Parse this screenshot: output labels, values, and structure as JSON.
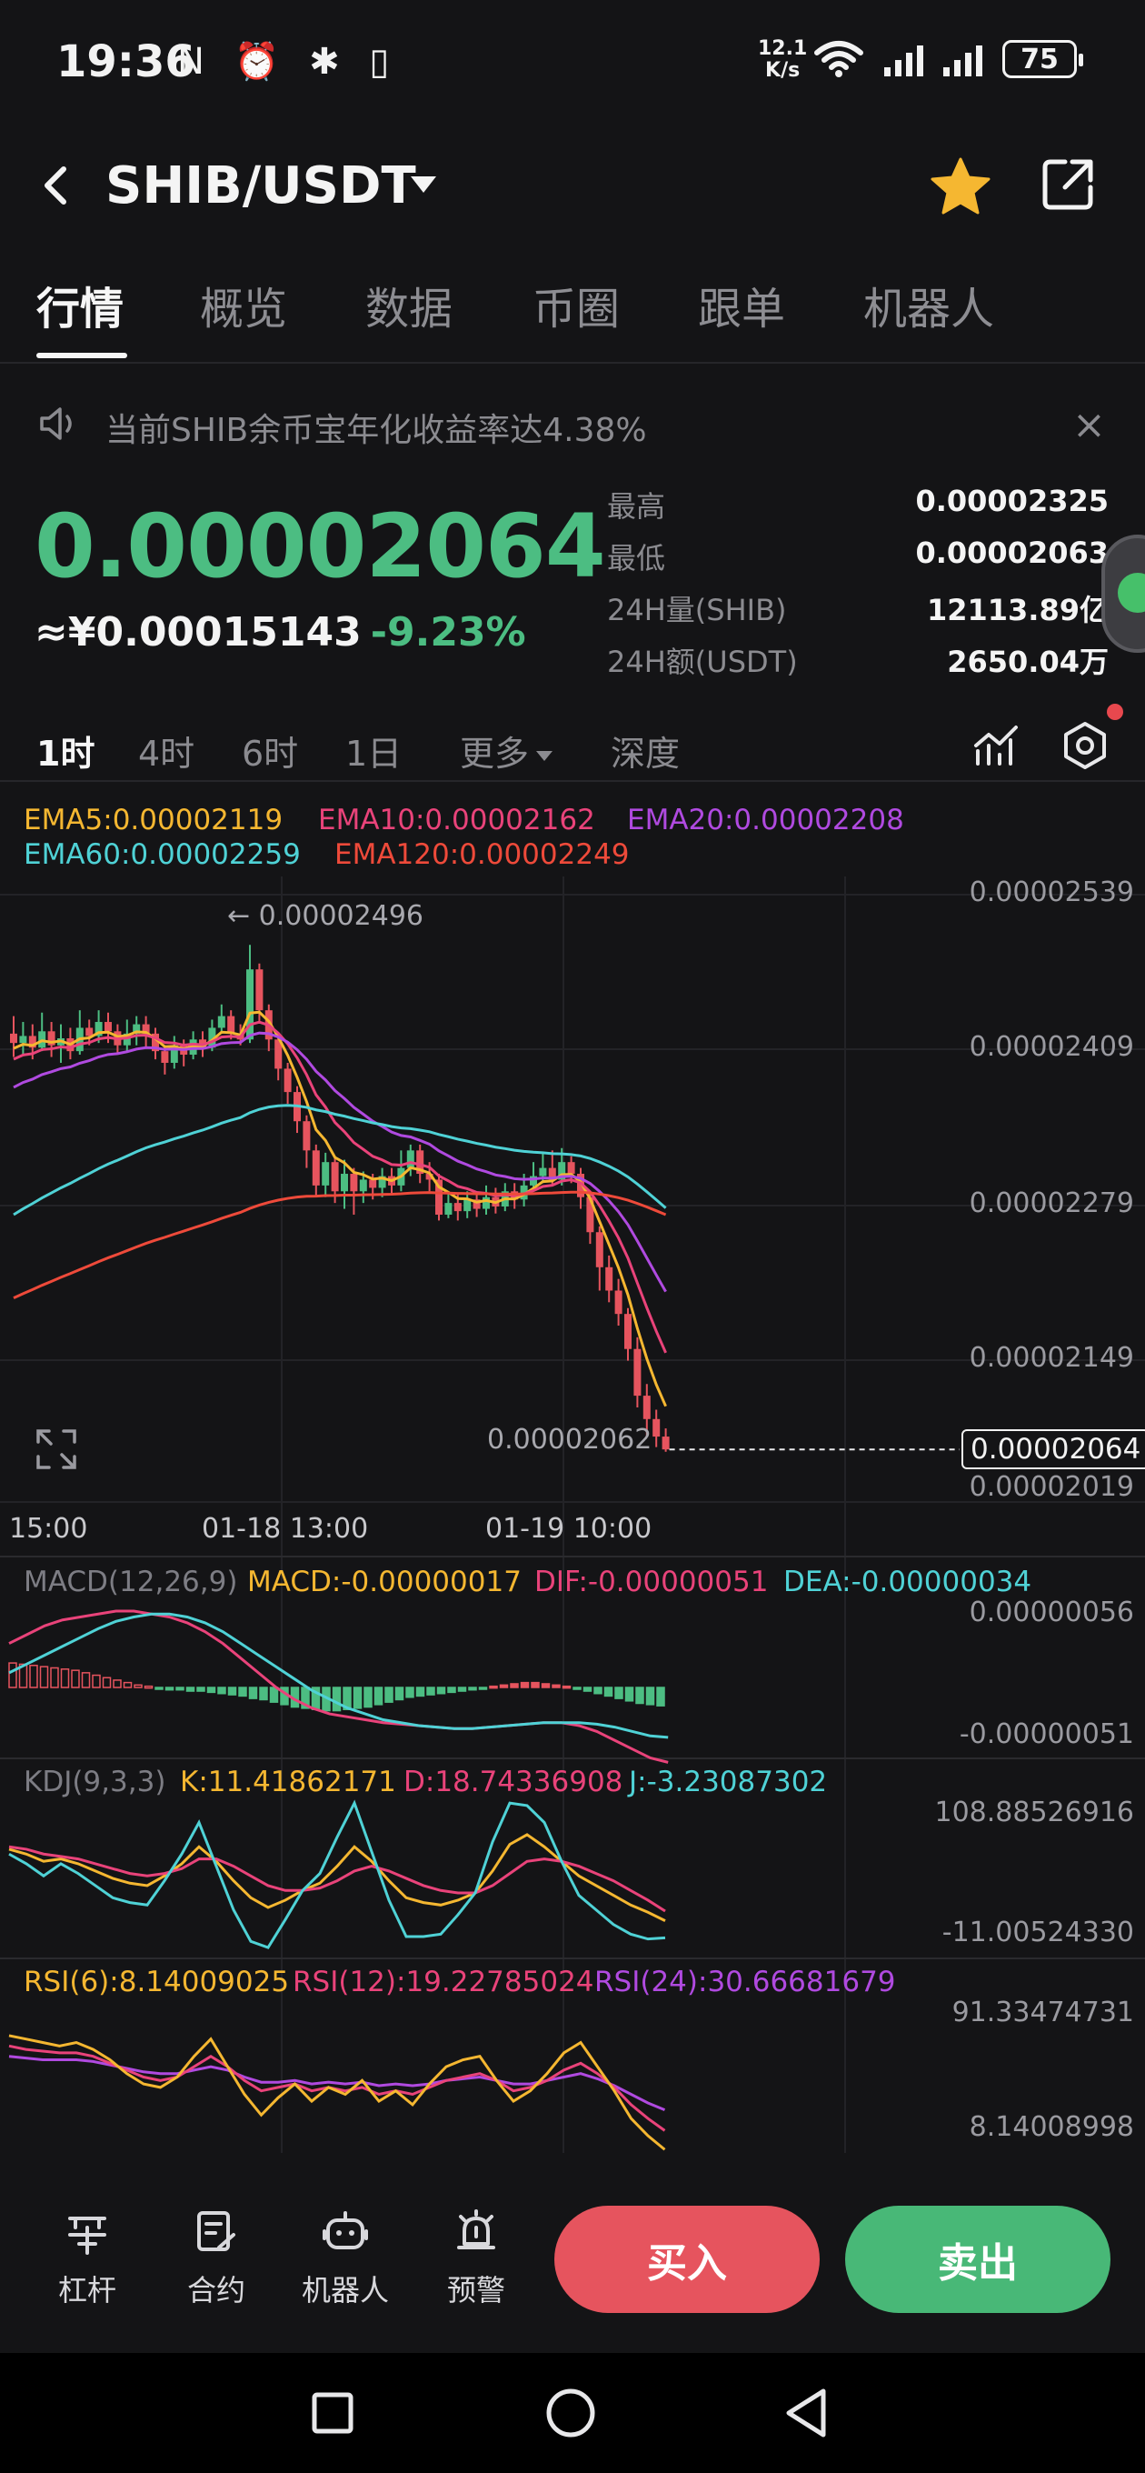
{
  "status_bar": {
    "time": "19:36",
    "left_icons": "N ⏰ ✱ ▯",
    "net_speed_value": "12.1",
    "net_speed_unit": "K/s",
    "battery": "75"
  },
  "header": {
    "pair": "SHIB/USDT",
    "favorite_color": "#f5b731"
  },
  "tabs": [
    "行情",
    "概览",
    "数据",
    "币圈",
    "跟单",
    "机器人"
  ],
  "notice": {
    "text": "当前SHIB余币宝年化收益率达4.38%",
    "close": "×"
  },
  "ticker": {
    "price": "0.00002064",
    "price_cny": "≈¥0.00015143",
    "change": "-9.23%",
    "stats": [
      {
        "label": "最高",
        "value": "0.00002325"
      },
      {
        "label": "最低",
        "value": "0.00002063"
      },
      {
        "label": "24H量(SHIB)",
        "value": "12113.89亿"
      },
      {
        "label": "24H额(USDT)",
        "value": "2650.04万"
      }
    ]
  },
  "timeframes": {
    "items": [
      "1时",
      "4时",
      "6时",
      "1日"
    ],
    "more": "更多",
    "depth": "深度",
    "active": "1时"
  },
  "chart_data": [
    {
      "type": "line",
      "title": "",
      "legend": [
        {
          "name": "EMA5:0.00002119",
          "color": "#f5b731"
        },
        {
          "name": "EMA10:0.00002162",
          "color": "#e9437a"
        },
        {
          "name": "EMA20:0.00002208",
          "color": "#b04ae0"
        },
        {
          "name": "EMA60:0.00002259",
          "color": "#4fd2d6"
        },
        {
          "name": "EMA120:0.00002249",
          "color": "#ee4a3a"
        }
      ],
      "y_ticks": [
        "0.00002539",
        "0.00002409",
        "0.00002279",
        "0.00002149",
        "0.00002019"
      ],
      "x_ticks": [
        "15:00",
        "01-18 13:00",
        "01-19 10:00"
      ],
      "ylim": [
        2.019e-05,
        2.539e-05
      ],
      "high_marker": "← 0.00002496",
      "low_marker": "0.00002062",
      "last_price": "0.00002064",
      "colors": {
        "up": "#4cbd82",
        "down": "#e6545e"
      },
      "candles": [
        [
          2420,
          2412,
          2435,
          2400
        ],
        [
          2412,
          2418,
          2430,
          2402
        ],
        [
          2418,
          2408,
          2428,
          2398
        ],
        [
          2408,
          2422,
          2438,
          2405
        ],
        [
          2422,
          2410,
          2430,
          2400
        ],
        [
          2410,
          2416,
          2428,
          2395
        ],
        [
          2416,
          2405,
          2425,
          2398
        ],
        [
          2405,
          2425,
          2440,
          2402
        ],
        [
          2425,
          2418,
          2432,
          2410
        ],
        [
          2418,
          2430,
          2440,
          2412
        ],
        [
          2430,
          2422,
          2438,
          2412
        ],
        [
          2422,
          2410,
          2428,
          2402
        ],
        [
          2410,
          2420,
          2432,
          2405
        ],
        [
          2420,
          2428,
          2435,
          2410
        ],
        [
          2428,
          2420,
          2435,
          2408
        ],
        [
          2420,
          2405,
          2425,
          2398
        ],
        [
          2405,
          2395,
          2410,
          2385
        ],
        [
          2395,
          2410,
          2418,
          2390
        ],
        [
          2410,
          2402,
          2415,
          2392
        ],
        [
          2402,
          2415,
          2422,
          2398
        ],
        [
          2415,
          2408,
          2422,
          2400
        ],
        [
          2408,
          2425,
          2432,
          2405
        ],
        [
          2425,
          2435,
          2445,
          2420
        ],
        [
          2435,
          2420,
          2440,
          2415
        ],
        [
          2420,
          2415,
          2428,
          2410
        ],
        [
          2415,
          2475,
          2496,
          2412
        ],
        [
          2475,
          2440,
          2480,
          2430
        ],
        [
          2440,
          2415,
          2445,
          2405
        ],
        [
          2415,
          2390,
          2420,
          2380
        ],
        [
          2390,
          2370,
          2395,
          2360
        ],
        [
          2370,
          2345,
          2375,
          2335
        ],
        [
          2345,
          2320,
          2350,
          2305
        ],
        [
          2320,
          2290,
          2325,
          2280
        ],
        [
          2290,
          2310,
          2318,
          2280
        ],
        [
          2310,
          2285,
          2315,
          2275
        ],
        [
          2285,
          2300,
          2312,
          2270
        ],
        [
          2300,
          2285,
          2305,
          2265
        ],
        [
          2285,
          2295,
          2302,
          2275
        ],
        [
          2295,
          2288,
          2300,
          2278
        ],
        [
          2288,
          2298,
          2305,
          2280
        ],
        [
          2298,
          2290,
          2305,
          2282
        ],
        [
          2290,
          2305,
          2320,
          2285
        ],
        [
          2305,
          2320,
          2325,
          2298
        ],
        [
          2320,
          2300,
          2325,
          2292
        ],
        [
          2300,
          2295,
          2310,
          2285
        ],
        [
          2295,
          2265,
          2300,
          2260
        ],
        [
          2265,
          2275,
          2285,
          2262
        ],
        [
          2275,
          2268,
          2282,
          2260
        ],
        [
          2268,
          2278,
          2285,
          2262
        ],
        [
          2278,
          2270,
          2285,
          2263
        ],
        [
          2270,
          2280,
          2290,
          2265
        ],
        [
          2280,
          2272,
          2288,
          2266
        ],
        [
          2272,
          2285,
          2292,
          2268
        ],
        [
          2285,
          2278,
          2292,
          2270
        ],
        [
          2278,
          2290,
          2300,
          2272
        ],
        [
          2290,
          2298,
          2310,
          2285
        ],
        [
          2298,
          2305,
          2318,
          2292
        ],
        [
          2305,
          2295,
          2320,
          2290
        ],
        [
          2295,
          2310,
          2322,
          2290
        ],
        [
          2310,
          2300,
          2315,
          2292
        ],
        [
          2300,
          2280,
          2305,
          2270
        ],
        [
          2280,
          2250,
          2285,
          2240
        ],
        [
          2250,
          2220,
          2255,
          2200
        ],
        [
          2220,
          2200,
          2230,
          2190
        ],
        [
          2200,
          2180,
          2210,
          2170
        ],
        [
          2180,
          2150,
          2185,
          2140
        ],
        [
          2150,
          2110,
          2160,
          2100
        ],
        [
          2110,
          2090,
          2120,
          2075
        ],
        [
          2090,
          2075,
          2098,
          2066
        ],
        [
          2075,
          2064,
          2082,
          2062
        ]
      ]
    },
    {
      "type": "bar",
      "title": "MACD(12,26,9)",
      "legend": [
        {
          "name": "MACD:-0.00000017",
          "color": "#f5b731"
        },
        {
          "name": "DIF:-0.00000051",
          "color": "#e9437a"
        },
        {
          "name": "DEA:-0.00000034",
          "color": "#4fd2d6"
        }
      ],
      "y_ticks": [
        "0.00000056",
        "-0.00000051"
      ],
      "ylim": [
        -51,
        56
      ],
      "histogram": [
        20,
        19,
        18,
        17,
        16,
        15,
        14,
        12,
        10,
        8,
        6,
        4,
        2,
        1,
        -1,
        -2,
        -2,
        -3,
        -3,
        -4,
        -5,
        -6,
        -7,
        -9,
        -10,
        -12,
        -14,
        -16,
        -17,
        -18,
        -19,
        -19,
        -18,
        -17,
        -16,
        -14,
        -12,
        -10,
        -8,
        -7,
        -6,
        -5,
        -4,
        -3,
        -2,
        -1,
        1,
        2,
        3,
        4,
        4,
        3,
        2,
        1,
        -1,
        -3,
        -5,
        -7,
        -9,
        -11,
        -13,
        -14,
        -15
      ],
      "dif": [
        30,
        36,
        42,
        46,
        48,
        50,
        52,
        52,
        50,
        48,
        44,
        38,
        30,
        20,
        10,
        0,
        -8,
        -14,
        -18,
        -20,
        -22,
        -24,
        -25,
        -26,
        -27,
        -28,
        -28,
        -27,
        -26,
        -25,
        -24,
        -24,
        -26,
        -30,
        -36,
        -42,
        -48,
        -51
      ],
      "dea": [
        10,
        16,
        22,
        28,
        34,
        40,
        45,
        48,
        50,
        50,
        48,
        44,
        38,
        30,
        22,
        14,
        6,
        -2,
        -8,
        -14,
        -18,
        -22,
        -24,
        -26,
        -27,
        -28,
        -28,
        -27,
        -26,
        -25,
        -24,
        -24,
        -24,
        -25,
        -27,
        -30,
        -33,
        -34
      ]
    },
    {
      "type": "line",
      "title": "KDJ(9,3,3)",
      "legend": [
        {
          "name": "K:11.41862171",
          "color": "#f5b731"
        },
        {
          "name": "D:18.74336908",
          "color": "#e9437a"
        },
        {
          "name": "J:-3.23087302",
          "color": "#4fd2d6"
        }
      ],
      "y_ticks": [
        "108.88526916",
        "-11.00524330"
      ],
      "ylim": [
        -11.0,
        108.9
      ],
      "k": [
        70,
        66,
        60,
        62,
        58,
        52,
        46,
        42,
        40,
        48,
        58,
        72,
        60,
        44,
        30,
        22,
        28,
        36,
        42,
        56,
        72,
        60,
        44,
        30,
        26,
        24,
        28,
        34,
        52,
        74,
        82,
        72,
        60,
        48,
        40,
        32,
        24,
        18,
        11
      ],
      "d": [
        72,
        70,
        66,
        64,
        62,
        58,
        54,
        50,
        48,
        50,
        54,
        62,
        62,
        56,
        48,
        40,
        36,
        36,
        38,
        44,
        52,
        56,
        52,
        46,
        40,
        36,
        34,
        34,
        40,
        50,
        60,
        62,
        60,
        56,
        50,
        44,
        36,
        28,
        19
      ],
      "j": [
        66,
        58,
        48,
        58,
        50,
        40,
        30,
        26,
        24,
        44,
        66,
        92,
        56,
        20,
        -6,
        -11,
        12,
        36,
        50,
        80,
        108,
        68,
        28,
        -2,
        -2,
        0,
        16,
        34,
        76,
        108,
        106,
        92,
        60,
        32,
        20,
        8,
        0,
        -4,
        -3
      ]
    },
    {
      "type": "line",
      "title": "",
      "legend": [
        {
          "name": "RSI(6):8.14009025",
          "color": "#f5b731"
        },
        {
          "name": "RSI(12):19.22785024",
          "color": "#e9437a"
        },
        {
          "name": "RSI(24):30.66681679",
          "color": "#b04ae0"
        }
      ],
      "y_ticks": [
        "91.33474731",
        "8.14008998"
      ],
      "ylim": [
        8.14,
        91.33
      ],
      "rsi6": [
        74,
        72,
        70,
        68,
        70,
        66,
        60,
        52,
        46,
        44,
        50,
        62,
        72,
        56,
        40,
        28,
        38,
        46,
        36,
        44,
        40,
        48,
        36,
        42,
        34,
        46,
        56,
        60,
        62,
        48,
        36,
        42,
        52,
        64,
        70,
        56,
        42,
        26,
        16,
        8
      ],
      "rsi12": [
        68,
        66,
        65,
        64,
        64,
        62,
        58,
        54,
        50,
        48,
        50,
        56,
        62,
        56,
        48,
        42,
        44,
        46,
        42,
        44,
        42,
        44,
        40,
        42,
        40,
        44,
        48,
        50,
        52,
        48,
        42,
        44,
        48,
        54,
        58,
        52,
        44,
        34,
        26,
        19
      ],
      "rsi24": [
        62,
        61,
        60,
        60,
        60,
        59,
        57,
        55,
        53,
        52,
        52,
        54,
        56,
        54,
        50,
        47,
        47,
        48,
        46,
        47,
        46,
        47,
        45,
        46,
        45,
        46,
        48,
        49,
        50,
        48,
        46,
        46,
        48,
        50,
        52,
        49,
        45,
        40,
        35,
        31
      ]
    }
  ],
  "bottom_bar": {
    "actions": [
      {
        "label": "杠杆",
        "icon": "leverage-icon"
      },
      {
        "label": "合约",
        "icon": "contract-icon"
      },
      {
        "label": "机器人",
        "icon": "robot-icon"
      },
      {
        "label": "预警",
        "icon": "alert-icon"
      }
    ],
    "buy": "买入",
    "sell": "卖出"
  }
}
